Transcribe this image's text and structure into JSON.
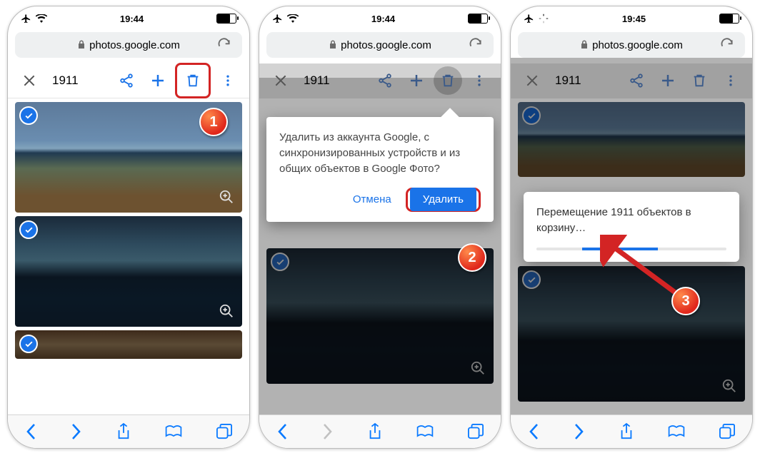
{
  "screens": [
    {
      "time": "19:44",
      "url": "photos.google.com",
      "selection_count": "1911"
    },
    {
      "time": "19:44",
      "url": "photos.google.com",
      "selection_count": "1911",
      "dialog": {
        "message": "Удалить из аккаунта Google, с синхронизированных устройств и из общих объектов в Google Фото?",
        "cancel": "Отмена",
        "confirm": "Удалить"
      }
    },
    {
      "time": "19:45",
      "url": "photos.google.com",
      "selection_count": "1911",
      "toast": "Перемещение 1911 объектов в корзину…"
    }
  ],
  "badges": [
    "1",
    "2",
    "3"
  ]
}
